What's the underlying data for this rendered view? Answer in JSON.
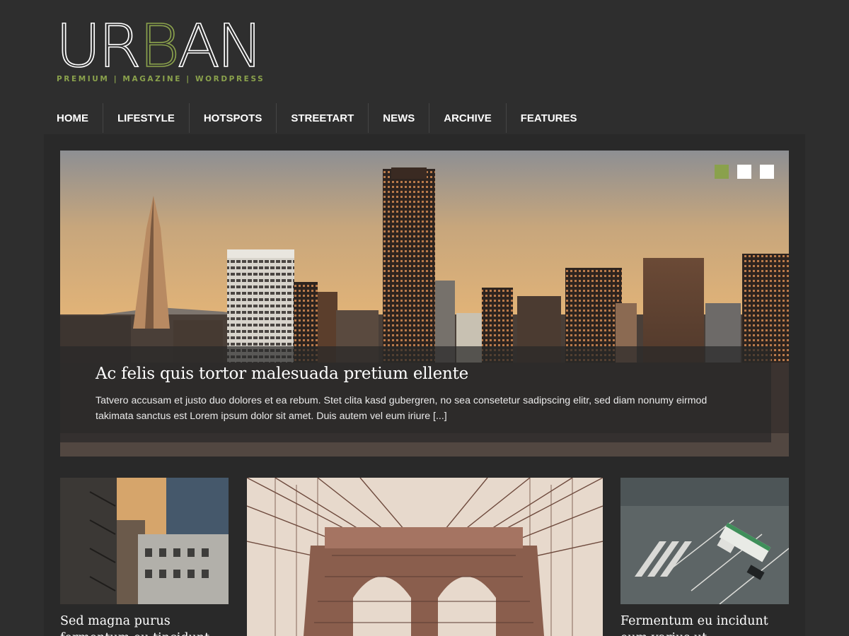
{
  "logo": {
    "letters": [
      "U",
      "R",
      "B",
      "A",
      "N"
    ],
    "accent_letter_index": 2,
    "tagline": "PREMIUM | MAGAZINE | WORDPRESS"
  },
  "nav": {
    "items": [
      {
        "label": "HOME"
      },
      {
        "label": "LIFESTYLE"
      },
      {
        "label": "HOTSPOTS"
      },
      {
        "label": "STREETART"
      },
      {
        "label": "NEWS"
      },
      {
        "label": "ARCHIVE"
      },
      {
        "label": "FEATURES"
      }
    ]
  },
  "hero": {
    "title": "Ac felis quis tortor malesuada pretium ellente",
    "excerpt": "Tatvero accusam et justo duo dolores et ea rebum. Stet clita kasd gubergren, no sea consetetur sadipscing elitr, sed diam nonumy eirmod takimata sanctus est Lorem ipsum dolor sit amet. Duis autem vel eum iriure [...]",
    "slides": 3,
    "active_slide": 0
  },
  "cards": [
    {
      "title": "Sed magna purus fermentum eu tincidunt"
    },
    {
      "title": ""
    },
    {
      "title": "Fermentum eu incidunt eum varius ut"
    }
  ],
  "colors": {
    "accent": "#8aa14c",
    "background": "#2e2e2e",
    "panel": "#292929"
  }
}
